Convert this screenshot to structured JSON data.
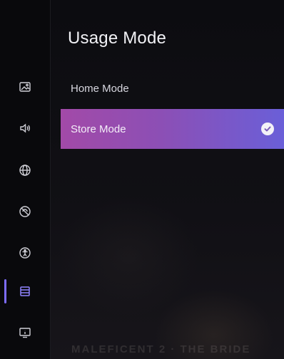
{
  "menu": {
    "title": "Usage Mode",
    "options": [
      {
        "label": "Home Mode",
        "selected": false
      },
      {
        "label": "Store Mode",
        "selected": true
      }
    ]
  },
  "sidebar": {
    "items": [
      {
        "icon": "picture-icon",
        "active": false
      },
      {
        "icon": "sound-icon",
        "active": false
      },
      {
        "icon": "globe-icon",
        "active": false
      },
      {
        "icon": "no-signal-icon",
        "active": false
      },
      {
        "icon": "accessibility-icon",
        "active": false
      },
      {
        "icon": "list-icon",
        "active": true
      },
      {
        "icon": "info-icon",
        "active": false
      }
    ]
  },
  "background": {
    "faint_text": "MALEFICENT 2 · THE BRIDE"
  },
  "colors": {
    "highlight_start": "#a24aa8",
    "highlight_end": "#6a5fd8",
    "active_indicator": "#7d6cff"
  }
}
